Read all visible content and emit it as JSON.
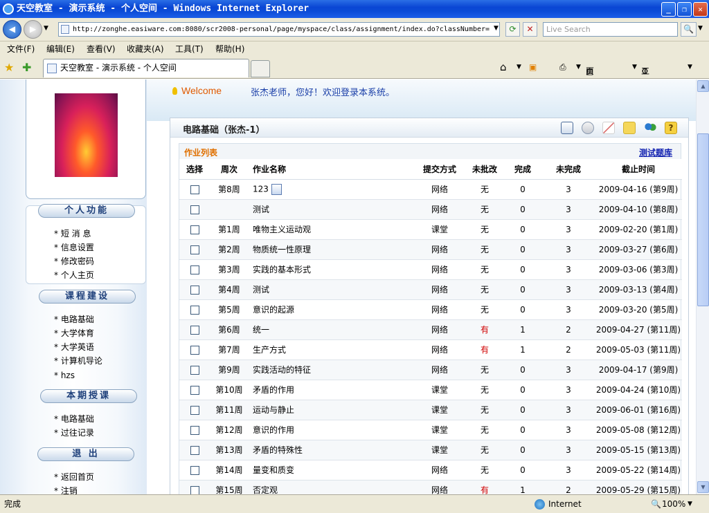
{
  "window": {
    "title": "天空教室 - 演示系统 - 个人空间 - Windows Internet Explorer"
  },
  "address": {
    "url": "http://zonghe.easiware.com:8080/scr2008-personal/page/myspace/class/assignment/index.do?classNumber=",
    "search_placeholder": "Live Search"
  },
  "menu": [
    "文件(F)",
    "编辑(E)",
    "查看(V)",
    "收藏夹(A)",
    "工具(T)",
    "帮助(H)"
  ],
  "tab": {
    "label": "天空教室 - 演示系统 - 个人空间"
  },
  "toolbar": {
    "page_label": "页面(P)",
    "tools_label": "工具(O)"
  },
  "header": {
    "welcome": "Welcome",
    "greeting": "张杰老师，您好！欢迎登录本系统。"
  },
  "sidebar": {
    "personal": {
      "title": "个人功能",
      "items": [
        "短 消 息",
        "信息设置",
        "修改密码",
        "个人主页"
      ]
    },
    "courses": {
      "title": "课程建设",
      "items": [
        "电路基础",
        "大学体育",
        "大学英语",
        "计算机导论",
        "hzs"
      ]
    },
    "term": {
      "title": "本期授课",
      "items": [
        "电路基础",
        "过往记录"
      ]
    },
    "exit": {
      "title": "退 出",
      "items": [
        "返回首页",
        "注销"
      ]
    }
  },
  "course": {
    "title": "电路基础（张杰-1）",
    "list_title": "作业列表",
    "test_library": "测试题库",
    "icons": [
      "calendar-icon",
      "link-icon",
      "edit-icon",
      "note-icon",
      "users-icon",
      "help-icon"
    ]
  },
  "table": {
    "headers": [
      "选择",
      "周次",
      "作业名称",
      "提交方式",
      "未批改",
      "完成",
      "未完成",
      "截止时间"
    ],
    "rows": [
      {
        "week": "第8周",
        "name": "123",
        "mode": "网络",
        "unmarked": "无",
        "done": "0",
        "undone": "3",
        "deadline": "2009-04-16 (第9周)"
      },
      {
        "week": "",
        "name": "测试",
        "mode": "网络",
        "unmarked": "无",
        "done": "0",
        "undone": "3",
        "deadline": "2009-04-10 (第8周)"
      },
      {
        "week": "第1周",
        "name": "唯物主义运动观",
        "mode": "课堂",
        "unmarked": "无",
        "done": "0",
        "undone": "3",
        "deadline": "2009-02-20 (第1周)"
      },
      {
        "week": "第2周",
        "name": "物质统一性原理",
        "mode": "网络",
        "unmarked": "无",
        "done": "0",
        "undone": "3",
        "deadline": "2009-03-27 (第6周)"
      },
      {
        "week": "第3周",
        "name": "实践的基本形式",
        "mode": "网络",
        "unmarked": "无",
        "done": "0",
        "undone": "3",
        "deadline": "2009-03-06 (第3周)"
      },
      {
        "week": "第4周",
        "name": "测试",
        "mode": "网络",
        "unmarked": "无",
        "done": "0",
        "undone": "3",
        "deadline": "2009-03-13 (第4周)"
      },
      {
        "week": "第5周",
        "name": "意识的起源",
        "mode": "网络",
        "unmarked": "无",
        "done": "0",
        "undone": "3",
        "deadline": "2009-03-20 (第5周)"
      },
      {
        "week": "第6周",
        "name": "统一",
        "mode": "网络",
        "unmarked": "有",
        "done": "1",
        "undone": "2",
        "deadline": "2009-04-27 (第11周)"
      },
      {
        "week": "第7周",
        "name": "生产方式",
        "mode": "网络",
        "unmarked": "有",
        "done": "1",
        "undone": "2",
        "deadline": "2009-05-03 (第11周)"
      },
      {
        "week": "第9周",
        "name": "实践活动的特征",
        "mode": "网络",
        "unmarked": "无",
        "done": "0",
        "undone": "3",
        "deadline": "2009-04-17 (第9周)"
      },
      {
        "week": "第10周",
        "name": "矛盾的作用",
        "mode": "课堂",
        "unmarked": "无",
        "done": "0",
        "undone": "3",
        "deadline": "2009-04-24 (第10周)"
      },
      {
        "week": "第11周",
        "name": "运动与静止",
        "mode": "课堂",
        "unmarked": "无",
        "done": "0",
        "undone": "3",
        "deadline": "2009-06-01 (第16周)"
      },
      {
        "week": "第12周",
        "name": "意识的作用",
        "mode": "课堂",
        "unmarked": "无",
        "done": "0",
        "undone": "3",
        "deadline": "2009-05-08 (第12周)"
      },
      {
        "week": "第13周",
        "name": "矛盾的特殊性",
        "mode": "课堂",
        "unmarked": "无",
        "done": "0",
        "undone": "3",
        "deadline": "2009-05-15 (第13周)"
      },
      {
        "week": "第14周",
        "name": "量变和质变",
        "mode": "网络",
        "unmarked": "无",
        "done": "0",
        "undone": "3",
        "deadline": "2009-05-22 (第14周)"
      },
      {
        "week": "第15周",
        "name": "否定观",
        "mode": "网络",
        "unmarked": "有",
        "done": "1",
        "undone": "2",
        "deadline": "2009-05-29 (第15周)"
      }
    ]
  },
  "status": {
    "left": "完成",
    "zone": "Internet",
    "zoom": "100%"
  }
}
